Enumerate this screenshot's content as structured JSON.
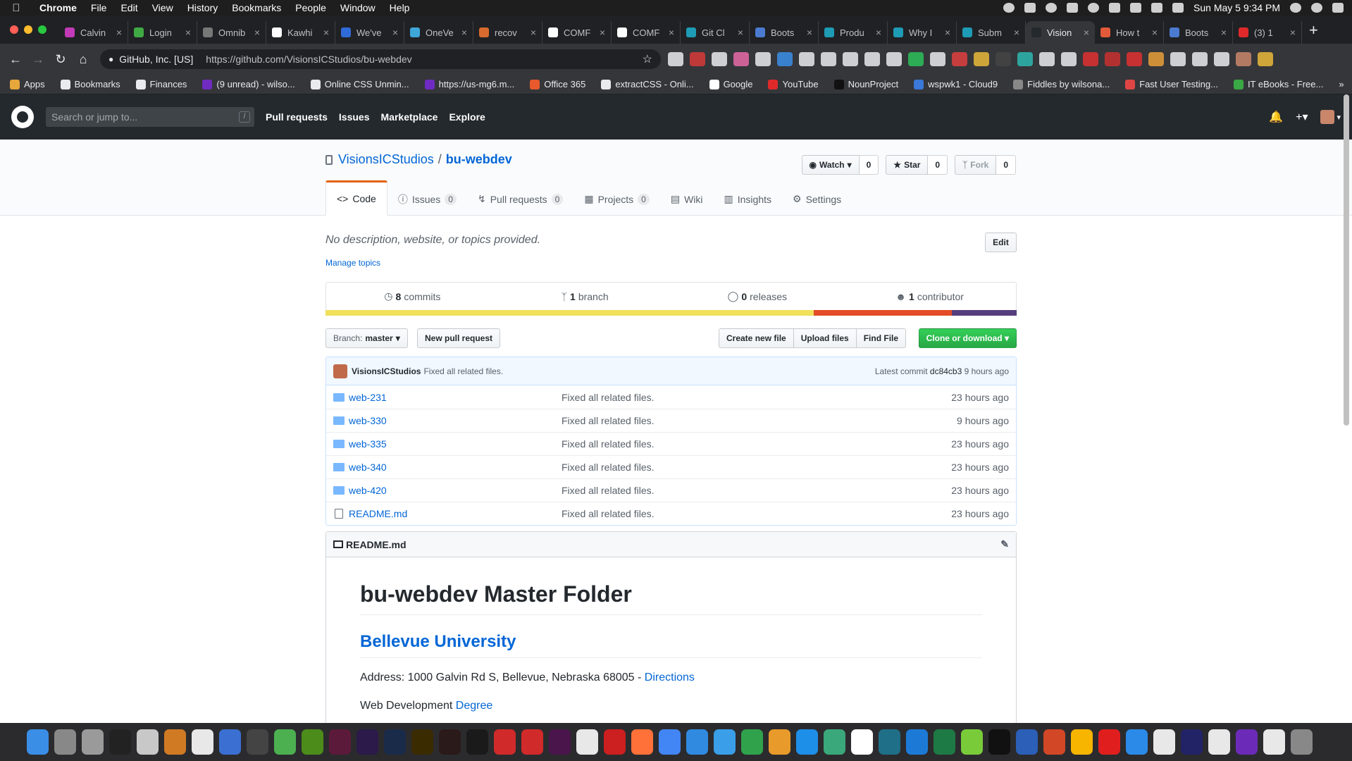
{
  "menubar": {
    "app": "Chrome",
    "items": [
      "File",
      "Edit",
      "View",
      "History",
      "Bookmarks",
      "People",
      "Window",
      "Help"
    ],
    "clock": "Sun May 5  9:34 PM"
  },
  "tabs": [
    {
      "label": "Calvin",
      "color": "#c23ab8"
    },
    {
      "label": "Login",
      "color": "#3fa944"
    },
    {
      "label": "Omnib",
      "color": "#777777"
    },
    {
      "label": "Kawhi",
      "color": "#ffffff"
    },
    {
      "label": "We've",
      "color": "#2f6bd8"
    },
    {
      "label": "OneVe",
      "color": "#3ea7d8"
    },
    {
      "label": "recov",
      "color": "#d86a2f"
    },
    {
      "label": "COMF",
      "color": "#ffffff"
    },
    {
      "label": "COMF",
      "color": "#ffffff"
    },
    {
      "label": "Git Cl",
      "color": "#1e9bb5"
    },
    {
      "label": "Boots",
      "color": "#4b7bd1"
    },
    {
      "label": "Produ",
      "color": "#1e9bb5"
    },
    {
      "label": "Why I",
      "color": "#1e9bb5"
    },
    {
      "label": "Subm",
      "color": "#1e9bb5"
    },
    {
      "label": "Vision",
      "color": "#24292e",
      "active": true
    },
    {
      "label": "How t",
      "color": "#e35a3a"
    },
    {
      "label": "Boots",
      "color": "#4b7bd1"
    },
    {
      "label": "(3) 1",
      "color": "#e02a2a"
    }
  ],
  "omnibox": {
    "org": "GitHub, Inc. [US]",
    "url": "https://github.com/VisionsICStudios/bu-webdev"
  },
  "bookmarks": [
    {
      "label": "Apps",
      "color": "#e8a73a"
    },
    {
      "label": "Bookmarks",
      "color": "#e8eaed"
    },
    {
      "label": "Finances",
      "color": "#e8eaed"
    },
    {
      "label": "(9 unread) - wilso...",
      "color": "#6f2bc2"
    },
    {
      "label": "Online CSS Unmin...",
      "color": "#e8eaed"
    },
    {
      "label": "https://us-mg6.m...",
      "color": "#6f2bc2"
    },
    {
      "label": "Office 365",
      "color": "#e8592c"
    },
    {
      "label": "extractCSS - Onli...",
      "color": "#e8eaed"
    },
    {
      "label": "Google",
      "color": "#ffffff"
    },
    {
      "label": "YouTube",
      "color": "#e02a2a"
    },
    {
      "label": "NounProject",
      "color": "#111111"
    },
    {
      "label": "wspwk1 - Cloud9",
      "color": "#3a78d9"
    },
    {
      "label": "Fiddles by wilsona...",
      "color": "#888888"
    },
    {
      "label": "Fast User Testing...",
      "color": "#e04545"
    },
    {
      "label": "IT eBooks - Free...",
      "color": "#3aa844"
    }
  ],
  "github": {
    "search_placeholder": "Search or jump to...",
    "slash": "/",
    "nav": [
      "Pull requests",
      "Issues",
      "Marketplace",
      "Explore"
    ]
  },
  "repo": {
    "owner": "VisionsICStudios",
    "name": "bu-webdev",
    "watch_label": "Watch",
    "watch_count": "0",
    "star_label": "Star",
    "star_count": "0",
    "fork_label": "Fork",
    "fork_count": "0",
    "tabs": [
      {
        "label": "Code"
      },
      {
        "label": "Issues",
        "count": "0"
      },
      {
        "label": "Pull requests",
        "count": "0"
      },
      {
        "label": "Projects",
        "count": "0"
      },
      {
        "label": "Wiki"
      },
      {
        "label": "Insights"
      },
      {
        "label": "Settings"
      }
    ],
    "description": "No description, website, or topics provided.",
    "manage_topics": "Manage topics",
    "edit_label": "Edit",
    "summary": {
      "commits_num": "8",
      "commits_label": "commits",
      "branch_num": "1",
      "branch_label": "branch",
      "releases_num": "0",
      "releases_label": "releases",
      "contributor_num": "1",
      "contributor_label": "contributor"
    },
    "languages": [
      {
        "color": "#f1e05a",
        "fraction": 0.706
      },
      {
        "color": "#e34c26",
        "fraction": 0.2
      },
      {
        "color": "#563d7c",
        "fraction": 0.094
      }
    ],
    "branch_prefix": "Branch:",
    "branch_name": "master",
    "new_pr": "New pull request",
    "create_file": "Create new file",
    "upload_files": "Upload files",
    "find_file": "Find File",
    "clone": "Clone or download",
    "commit": {
      "author": "VisionsICStudios",
      "message": "Fixed all related files.",
      "latest_label": "Latest commit",
      "sha": "dc84cb3",
      "age": "9 hours ago"
    },
    "files": [
      {
        "name": "web-231",
        "message": "Fixed all related files.",
        "age": "23 hours ago",
        "type": "dir"
      },
      {
        "name": "web-330",
        "message": "Fixed all related files.",
        "age": "9 hours ago",
        "type": "dir"
      },
      {
        "name": "web-335",
        "message": "Fixed all related files.",
        "age": "23 hours ago",
        "type": "dir"
      },
      {
        "name": "web-340",
        "message": "Fixed all related files.",
        "age": "23 hours ago",
        "type": "dir"
      },
      {
        "name": "web-420",
        "message": "Fixed all related files.",
        "age": "23 hours ago",
        "type": "dir"
      },
      {
        "name": "README.md",
        "message": "Fixed all related files.",
        "age": "23 hours ago",
        "type": "file"
      }
    ],
    "readme": {
      "filename": "README.md",
      "h1": "bu-webdev Master Folder",
      "h2": "Bellevue University",
      "address": "Address: 1000 Galvin Rd S, Bellevue, Nebraska 68005 - ",
      "directions": "Directions",
      "degree_prefix": "Web Development ",
      "degree": "Degree"
    }
  },
  "dock_colors": [
    "#3a8ee6",
    "#888888",
    "#9a9a9a",
    "#222222",
    "#c8c8c8",
    "#d07a24",
    "#e8e8e8",
    "#3b6fd1",
    "#444444",
    "#4caf50",
    "#4c8c1a",
    "#5c1a3a",
    "#2b1a4a",
    "#1a2b4a",
    "#3a2b00",
    "#2b1a1a",
    "#1a1a1a",
    "#d12a2a",
    "#d12a2a",
    "#4a154b",
    "#e8e8e8",
    "#cc1f1f",
    "#ff7139",
    "#4285f4",
    "#2f8ae0",
    "#3a9ee8",
    "#31a24c",
    "#e89a2a",
    "#1d8fe8",
    "#3aa87a",
    "#ffffff",
    "#1e6f87",
    "#1c7ad6",
    "#1e7a44",
    "#7acb3a",
    "#111111",
    "#2b5fb8",
    "#d24726",
    "#f7b500",
    "#e01e1e",
    "#2b8ae8",
    "#e8e8e8",
    "#222266",
    "#e8e8e8",
    "#6b2bb8",
    "#e8e8e8",
    "#888888"
  ]
}
